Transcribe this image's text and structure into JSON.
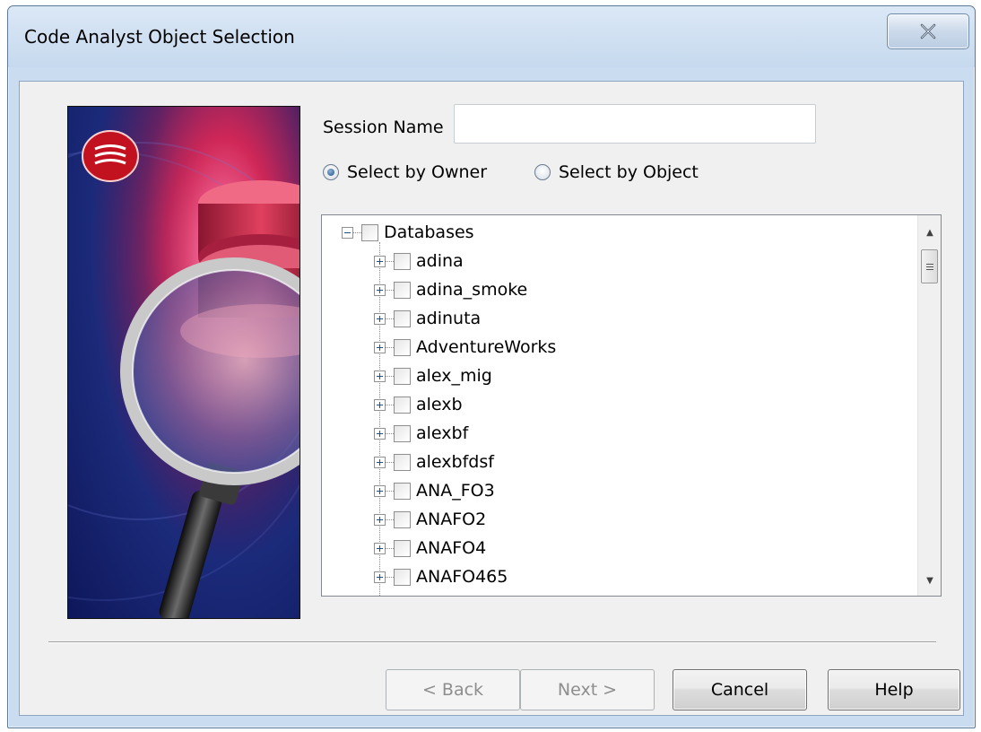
{
  "window": {
    "title": "Code Analyst Object Selection"
  },
  "form": {
    "session_label": "Session Name",
    "session_value": "",
    "radio_owner_label": "Select by Owner",
    "radio_object_label": "Select by Object",
    "selected_mode": "owner"
  },
  "tree": {
    "root_label": "Databases",
    "items": [
      {
        "label": "adina"
      },
      {
        "label": "adina_smoke"
      },
      {
        "label": "adinuta"
      },
      {
        "label": "AdventureWorks"
      },
      {
        "label": "alex_mig"
      },
      {
        "label": "alexb"
      },
      {
        "label": "alexbf"
      },
      {
        "label": "alexbfdsf"
      },
      {
        "label": "ANA_FO3"
      },
      {
        "label": "ANAFO2"
      },
      {
        "label": "ANAFO4"
      },
      {
        "label": "ANAFO465"
      }
    ]
  },
  "buttons": {
    "back_label": "< Back",
    "next_label": "Next >",
    "cancel_label": "Cancel",
    "help_label": "Help"
  },
  "colors": {
    "titlebar": "#c9dcf0",
    "dialog_bg": "#f0f0f0",
    "graphic_accent": "#c4204f"
  }
}
